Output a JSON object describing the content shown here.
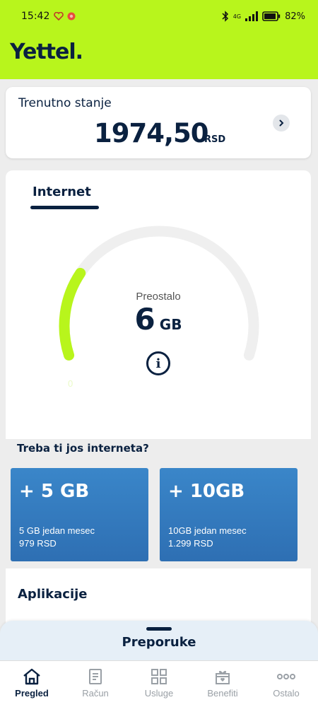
{
  "status_bar": {
    "time": "15:42",
    "signal_label": "4G",
    "battery": "82%"
  },
  "header": {
    "logo": "Yettel."
  },
  "balance": {
    "title": "Trenutno stanje",
    "amount": "1974,50",
    "currency": "RSD"
  },
  "internet": {
    "tab_label": "Internet",
    "remaining_label": "Preostalo",
    "remaining_value": "6",
    "remaining_unit": "GB",
    "gauge_min_label": "0",
    "gauge_fill_fraction": 0.24,
    "gauge_color": "#b8f51c"
  },
  "offers": {
    "title": "Treba ti jos interneta?",
    "items": [
      {
        "amount": "+ 5 GB",
        "description": "5 GB jedan mesec",
        "price": "979 RSD"
      },
      {
        "amount": "+ 10GB",
        "description": "10GB jedan mesec",
        "price": "1.299 RSD"
      }
    ]
  },
  "apps": {
    "title": "Aplikacije"
  },
  "recommendations": {
    "title": "Preporuke"
  },
  "nav": {
    "items": [
      {
        "label": "Pregled",
        "icon": "home-icon",
        "active": true
      },
      {
        "label": "Račun",
        "icon": "bill-icon",
        "active": false
      },
      {
        "label": "Usluge",
        "icon": "grid-icon",
        "active": false
      },
      {
        "label": "Benefiti",
        "icon": "gift-icon",
        "active": false
      },
      {
        "label": "Ostalo",
        "icon": "more-icon",
        "active": false
      }
    ]
  },
  "colors": {
    "brand": "#b8f51c",
    "navy": "#0a2140",
    "offer_blue": "#3a86c9"
  }
}
